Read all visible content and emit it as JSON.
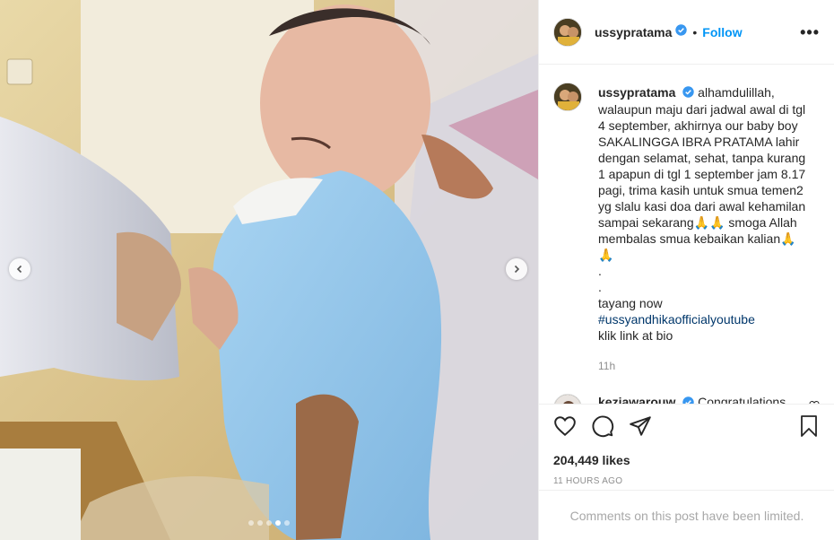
{
  "post": {
    "username": "ussypratama",
    "follow_label": "Follow",
    "bullet": "•",
    "more_label": "•••",
    "caption_lines": [
      "alhamdulillah,",
      "walaupun maju dari jadwal awal di tgl",
      "4 september, akhirnya our baby boy",
      "SAKALINGGA IBRA PRATAMA lahir",
      "dengan selamat, sehat, tanpa kurang",
      "1 apapun di tgl 1 september jam 8.17",
      "pagi, trima kasih untuk smua temen2",
      "yg slalu kasi doa dari awal kehamilan",
      "sampai sekarang🙏🙏 smoga Allah",
      "membalas smua kebaikan kalian🙏",
      "🙏",
      ".",
      ".",
      "tayang now"
    ],
    "hashtag": "#ussyandhikaofficialyoutube",
    "caption_end": "klik link at bio",
    "caption_time": "11h",
    "comment": {
      "username": "keziawarouw",
      "text": "Congratulations"
    },
    "likes": "204,449 likes",
    "posted_ago": "11 HOURS AGO",
    "comments_limited": "Comments on this post have been limited.",
    "carousel": {
      "slides": 5,
      "active_index": 3
    }
  },
  "colors": {
    "link": "#0095f6",
    "verified": "#3897f0",
    "hashtag": "#00376b",
    "muted": "#8e8e8e"
  }
}
